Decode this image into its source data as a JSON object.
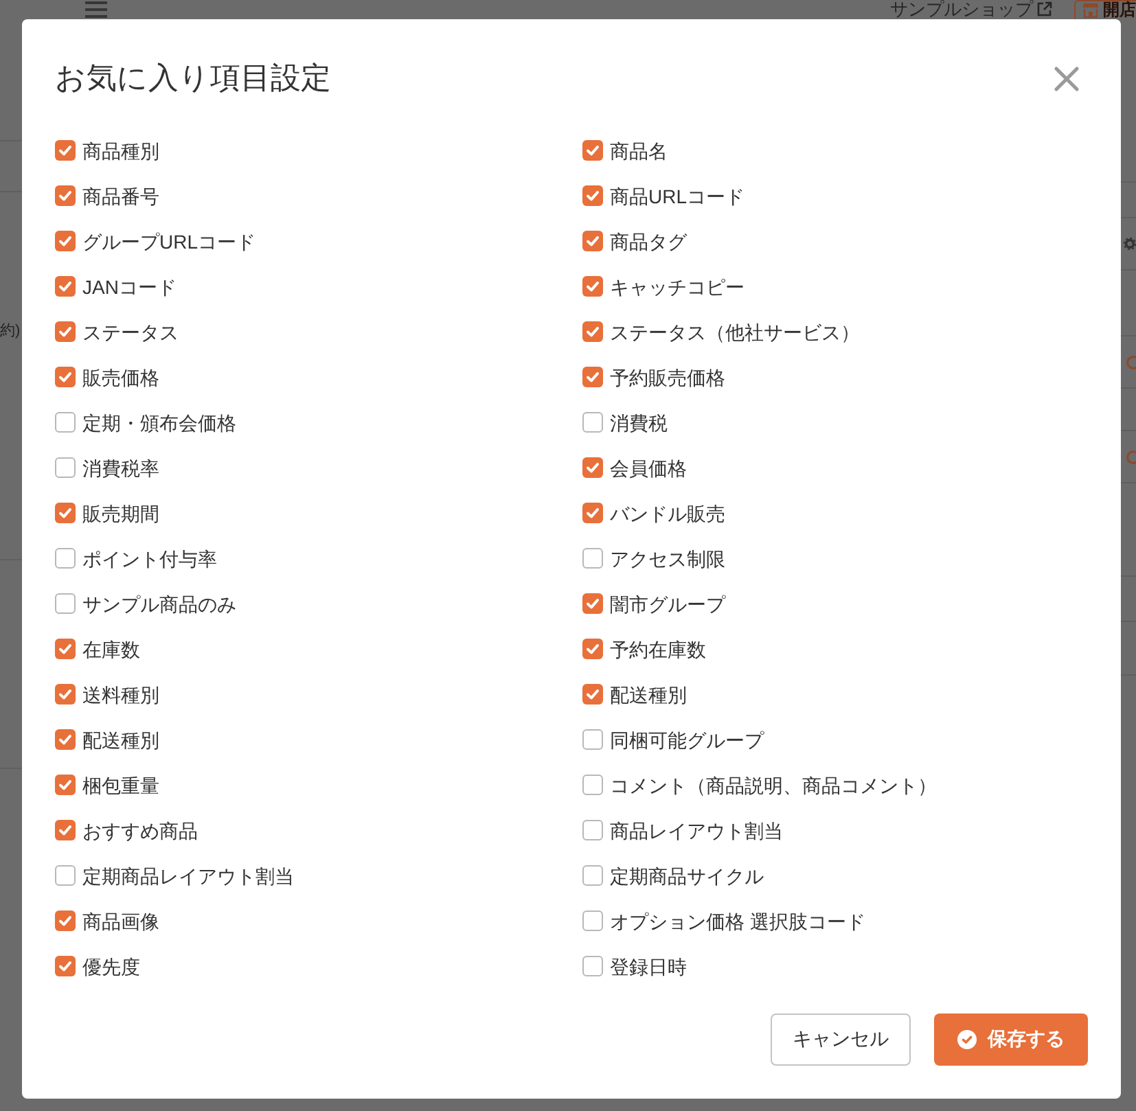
{
  "background_page": {
    "header": {
      "shop_link": "サンプルショップ",
      "store_button": "開店"
    },
    "left_column": {
      "cell_text": "約)"
    }
  },
  "dialog": {
    "title": "お気に入り項目設定",
    "fields": [
      {
        "label": "商品種別",
        "checked": true
      },
      {
        "label": "商品名",
        "checked": true
      },
      {
        "label": "商品番号",
        "checked": true
      },
      {
        "label": "商品URLコード",
        "checked": true
      },
      {
        "label": "グループURLコード",
        "checked": true
      },
      {
        "label": "商品タグ",
        "checked": true
      },
      {
        "label": "JANコード",
        "checked": true
      },
      {
        "label": "キャッチコピー",
        "checked": true
      },
      {
        "label": "ステータス",
        "checked": true
      },
      {
        "label": "ステータス（他社サービス）",
        "checked": true
      },
      {
        "label": "販売価格",
        "checked": true
      },
      {
        "label": "予約販売価格",
        "checked": true
      },
      {
        "label": "定期・頒布会価格",
        "checked": false
      },
      {
        "label": "消費税",
        "checked": false
      },
      {
        "label": "消費税率",
        "checked": false
      },
      {
        "label": "会員価格",
        "checked": true
      },
      {
        "label": "販売期間",
        "checked": true
      },
      {
        "label": "バンドル販売",
        "checked": true
      },
      {
        "label": "ポイント付与率",
        "checked": false
      },
      {
        "label": "アクセス制限",
        "checked": false
      },
      {
        "label": "サンプル商品のみ",
        "checked": false
      },
      {
        "label": "闇市グループ",
        "checked": true
      },
      {
        "label": "在庫数",
        "checked": true
      },
      {
        "label": "予約在庫数",
        "checked": true
      },
      {
        "label": "送料種別",
        "checked": true
      },
      {
        "label": "配送種別",
        "checked": true
      },
      {
        "label": "配送種別",
        "checked": true
      },
      {
        "label": "同梱可能グループ",
        "checked": false
      },
      {
        "label": "梱包重量",
        "checked": true
      },
      {
        "label": "コメント（商品説明、商品コメント）",
        "checked": false
      },
      {
        "label": "おすすめ商品",
        "checked": true
      },
      {
        "label": "商品レイアウト割当",
        "checked": false
      },
      {
        "label": "定期商品レイアウト割当",
        "checked": false
      },
      {
        "label": "定期商品サイクル",
        "checked": false
      },
      {
        "label": "商品画像",
        "checked": true
      },
      {
        "label": "オプション価格 選択肢コード",
        "checked": false
      },
      {
        "label": "優先度",
        "checked": true
      },
      {
        "label": "登録日時",
        "checked": false
      }
    ],
    "buttons": [
      {
        "label": "キャンセル",
        "kind": "secondary"
      },
      {
        "label": "保存する",
        "kind": "primary"
      }
    ]
  }
}
